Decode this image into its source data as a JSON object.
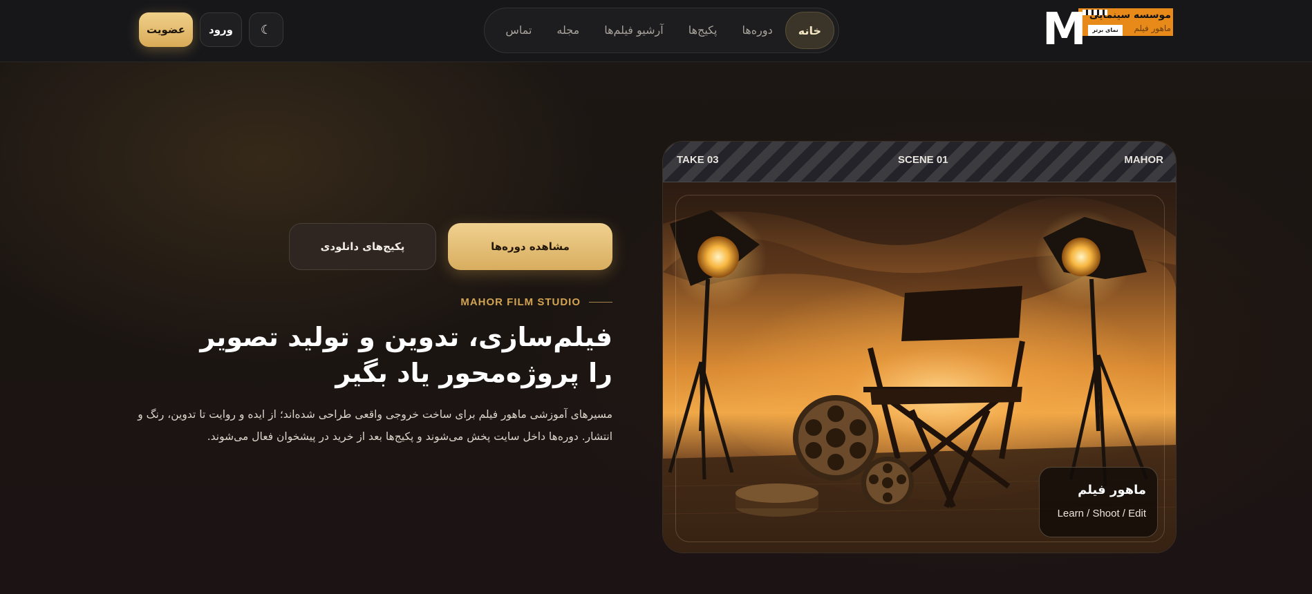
{
  "header": {
    "logo": {
      "title": "موسسه سینمایی",
      "subtitle": "ماهور فیلم",
      "tag": "نمای برتر"
    },
    "nav": [
      {
        "label": "خانه",
        "active": true
      },
      {
        "label": "دوره‌ها",
        "active": false
      },
      {
        "label": "پکیج‌ها",
        "active": false
      },
      {
        "label": "آرشیو فیلم‌ها",
        "active": false
      },
      {
        "label": "مجله",
        "active": false
      },
      {
        "label": "تماس",
        "active": false
      }
    ],
    "join_label": "عضویت",
    "login_label": "ورود",
    "theme_icon": "moon-icon",
    "theme_glyph": "☾"
  },
  "hero": {
    "primary_button": "مشاهده دوره‌ها",
    "secondary_button": "پکیج‌های دانلودی",
    "eyebrow": "MAHOR FILM STUDIO",
    "title": "فیلم‌سازی، تدوین و تولید تصویر را پروژه‌محور یاد بگیر",
    "description": "مسیرهای آموزشی ماهور فیلم برای ساخت خروجی واقعی طراحی شده‌اند؛ از ایده و روایت تا تدوین، رنگ و انتشار. دوره‌ها داخل سایت پخش می‌شوند و پکیج‌ها بعد از خرید در پیشخوان فعال می‌شوند."
  },
  "card": {
    "clapper": {
      "left": "TAKE 03",
      "center": "SCENE 01",
      "right": "MAHOR"
    },
    "caption_title": "ماهور فیلم",
    "caption_sub": "Learn / Shoot / Edit",
    "image_subject": "director-chair-film-set"
  },
  "colors": {
    "accent": "#d9ab57",
    "background": "#1a1412",
    "header": "#17171a",
    "logo_orange": "#e88a1a"
  }
}
